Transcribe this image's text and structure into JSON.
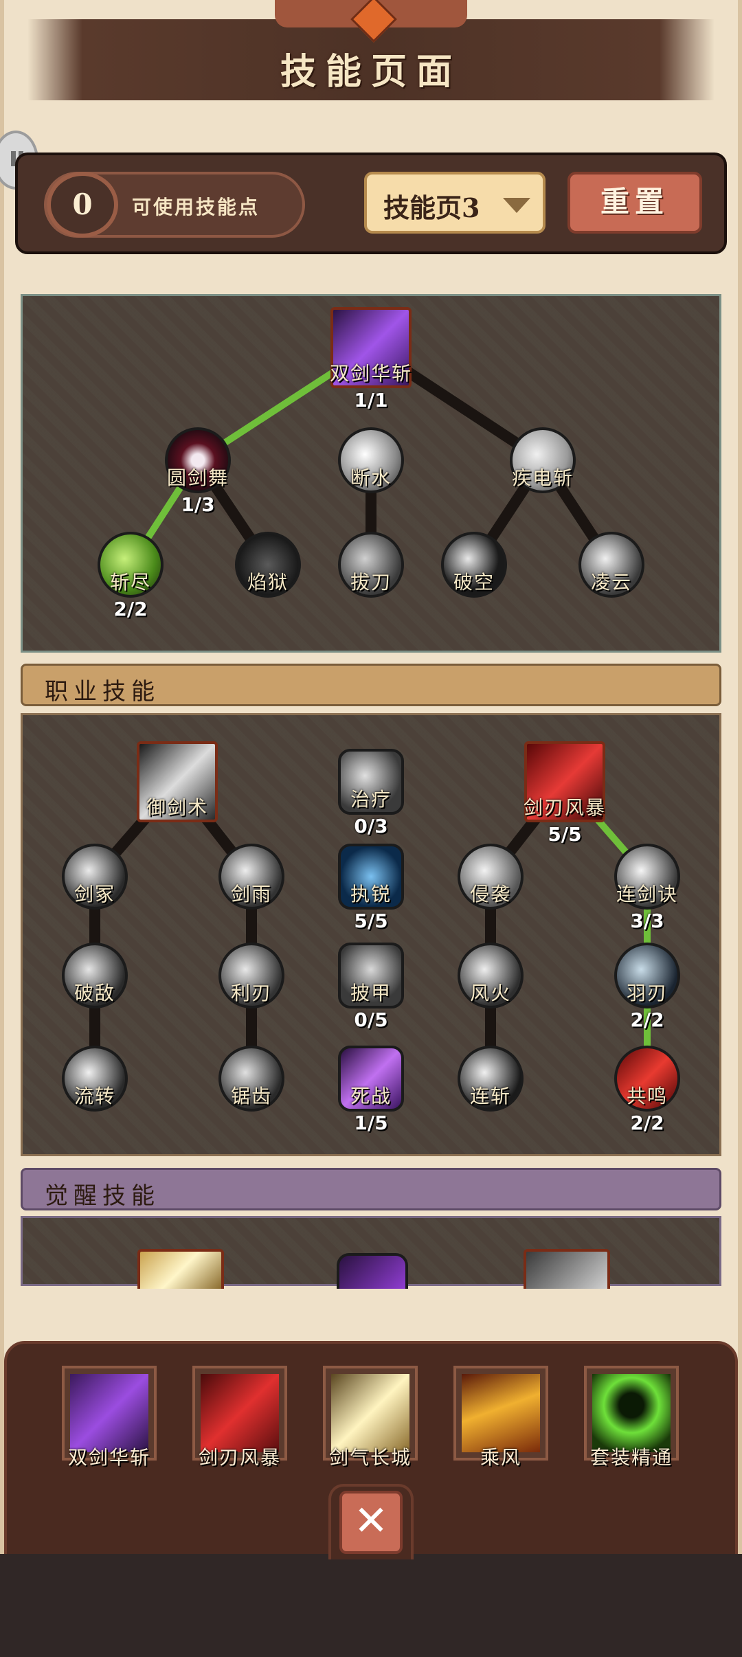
{
  "title": "技能页面",
  "top_bar": {
    "skill_points_value": "0",
    "skill_points_label": "可使用技能点",
    "skill_page_label": "技能页3",
    "reset_label": "重置"
  },
  "tree1": {
    "nodes": [
      {
        "name": "双剑华斩",
        "level": "1/1"
      },
      {
        "name": "圆剑舞",
        "level": "1/3"
      },
      {
        "name": "断水",
        "level": ""
      },
      {
        "name": "疾电斩",
        "level": ""
      },
      {
        "name": "斩尽",
        "level": "2/2"
      },
      {
        "name": "焰狱",
        "level": ""
      },
      {
        "name": "拔刀",
        "level": ""
      },
      {
        "name": "破空",
        "level": ""
      },
      {
        "name": "凌云",
        "level": ""
      }
    ]
  },
  "career": {
    "header": "职业技能",
    "nodes": [
      {
        "name": "御剑术",
        "level": ""
      },
      {
        "name": "治疗",
        "level": "0/3"
      },
      {
        "name": "剑刃风暴",
        "level": "5/5"
      },
      {
        "name": "剑冢",
        "level": ""
      },
      {
        "name": "剑雨",
        "level": ""
      },
      {
        "name": "执锐",
        "level": "5/5"
      },
      {
        "name": "侵袭",
        "level": ""
      },
      {
        "name": "连剑诀",
        "level": "3/3"
      },
      {
        "name": "破敌",
        "level": ""
      },
      {
        "name": "利刃",
        "level": ""
      },
      {
        "name": "披甲",
        "level": "0/5"
      },
      {
        "name": "风火",
        "level": ""
      },
      {
        "name": "羽刃",
        "level": "2/2"
      },
      {
        "name": "流转",
        "level": ""
      },
      {
        "name": "锯齿",
        "level": ""
      },
      {
        "name": "死战",
        "level": "1/5"
      },
      {
        "name": "连斩",
        "level": ""
      },
      {
        "name": "共鸣",
        "level": "2/2"
      }
    ]
  },
  "awaken": {
    "header": "觉醒技能"
  },
  "equipped": [
    {
      "name": "双剑华斩"
    },
    {
      "name": "剑刃风暴"
    },
    {
      "name": "剑气长城"
    },
    {
      "name": "乘风"
    },
    {
      "name": "套装精通"
    }
  ],
  "colors": {
    "active_link": "#6fbf3a",
    "inactive_link": "#1a1411",
    "panel_bg": "#4c4139",
    "page_bg": "#efe1c9"
  },
  "icons": {
    "close": "close-icon",
    "dropdown": "chevron-down-icon",
    "pause": "pause-icon"
  }
}
